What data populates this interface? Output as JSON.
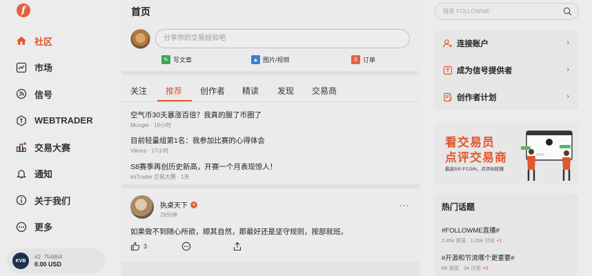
{
  "sidebar": {
    "logo": "f",
    "items": [
      {
        "label": "社区",
        "icon": "home-icon",
        "active": true
      },
      {
        "label": "市场",
        "icon": "chart-line-icon"
      },
      {
        "label": "信号",
        "icon": "signal-icon"
      },
      {
        "label": "WEBTRADER",
        "icon": "webtrader-icon"
      },
      {
        "label": "交易大赛",
        "icon": "contest-icon"
      },
      {
        "label": "通知",
        "icon": "bell-icon"
      },
      {
        "label": "关于我们",
        "icon": "info-icon"
      },
      {
        "label": "更多",
        "icon": "more-icon"
      }
    ],
    "account": {
      "broker": "KVB",
      "rank": "#2",
      "id": "754864",
      "balance": "0.00 USD"
    }
  },
  "feed": {
    "title": "首页",
    "composer_placeholder": "分享你的交易经验吧",
    "compose_actions": [
      "写文章",
      "图片/视频",
      "订单"
    ],
    "tabs": [
      "关注",
      "推荐",
      "创作者",
      "精读",
      "发现",
      "交易商"
    ],
    "active_tab": "推荐",
    "news": [
      {
        "title": "空气币30天暴涨百倍？我真的服了币圈了",
        "meta": "Munger · 19小时"
      },
      {
        "title": "目前轻量组第1名：我参加比赛的心得体会",
        "meta": "Vikovs · 17小时"
      },
      {
        "title": "S8赛季再创历史新高，开赛一个月表现惊人！",
        "meta": "imTrader 交易大赛 · 1天"
      }
    ],
    "post": {
      "user": "执桌天下",
      "time": "29分钟",
      "body": "如果做不到随心所欲，顺其自然，那最好还是坚守规则，按部就班。",
      "likes": "3"
    }
  },
  "right": {
    "search_placeholder": "搜索 FOLLOWME",
    "menu": [
      "连接账户",
      "成为信号提供者",
      "创作者计划"
    ],
    "banner": {
      "line1": "看交易员",
      "line2": "点评交易商",
      "line3": "最高500 FCOIN，点评你就赚"
    },
    "hot": {
      "title": "热门话题",
      "items": [
        {
          "title": "#FOLLOWME直播#",
          "views": "2.45k 浏览",
          "comments": "1.00k 讨论",
          "delta": "+1"
        },
        {
          "title": "#开源和节流哪个更重要#",
          "views": "89 浏览",
          "comments": "34 讨论",
          "delta": "+5"
        }
      ]
    }
  }
}
